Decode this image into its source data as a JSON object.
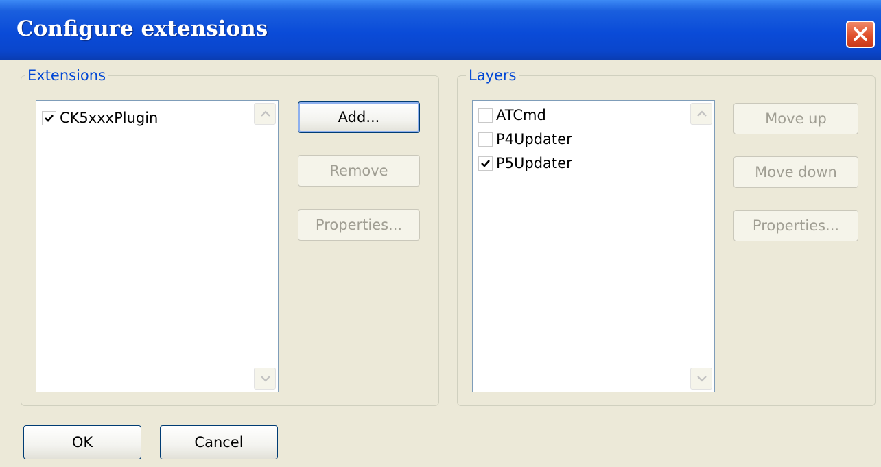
{
  "window": {
    "title": "Configure extensions",
    "close_icon": "close-icon"
  },
  "extensions": {
    "group_label": "Extensions",
    "items": [
      {
        "label": "CK5xxxPlugin",
        "checked": true
      }
    ],
    "buttons": {
      "add": "Add...",
      "remove": "Remove",
      "properties": "Properties..."
    }
  },
  "layers": {
    "group_label": "Layers",
    "items": [
      {
        "label": "ATCmd",
        "checked": false
      },
      {
        "label": "P4Updater",
        "checked": false
      },
      {
        "label": "P5Updater",
        "checked": true
      }
    ],
    "buttons": {
      "move_up": "Move up",
      "move_down": "Move down",
      "properties": "Properties..."
    }
  },
  "footer": {
    "ok": "OK",
    "cancel": "Cancel"
  },
  "colors": {
    "title_bar": "#0a4bd8",
    "group_label": "#0046d5",
    "dialog_bg": "#ece9d8",
    "close_button": "#e0512d"
  }
}
